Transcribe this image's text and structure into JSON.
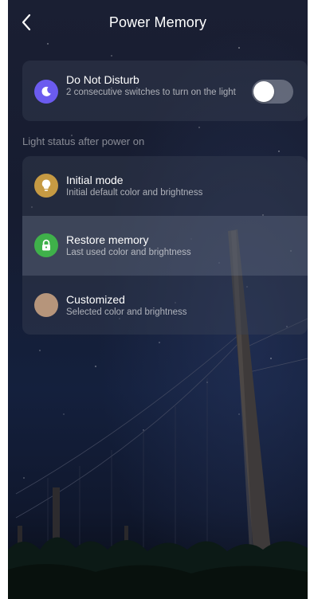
{
  "header": {
    "title": "Power Memory",
    "back_icon": "chevron-left-icon"
  },
  "dnd": {
    "title": "Do Not Disturb",
    "subtitle": "2 consecutive switches to turn on the light",
    "icon": "moon-icon",
    "icon_color": "#6B5BEF",
    "toggle_on": false
  },
  "section": {
    "label": "Light status after power on"
  },
  "options": [
    {
      "title": "Initial mode",
      "subtitle": "Initial default color and brightness",
      "icon": "bulb-icon",
      "icon_color": "#C69A43",
      "selected": false
    },
    {
      "title": "Restore memory",
      "subtitle": "Last used color and brightness",
      "icon": "lock-icon",
      "icon_color": "#3FB14A",
      "selected": true
    },
    {
      "title": "Customized",
      "subtitle": "Selected color and brightness",
      "icon": "color-swatch-icon",
      "icon_color": "#B6957B",
      "selected": false
    }
  ]
}
